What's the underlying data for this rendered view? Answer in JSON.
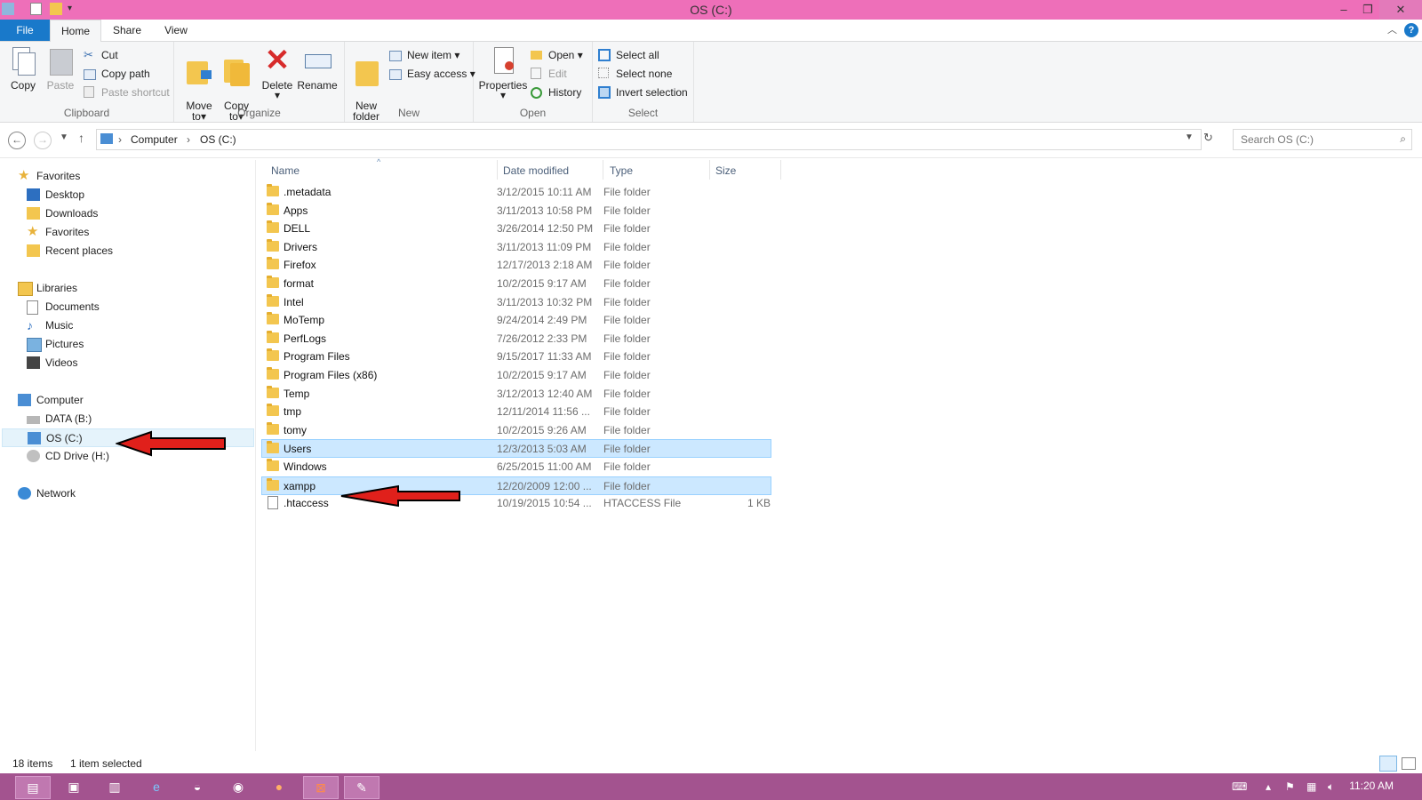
{
  "window": {
    "title": "OS (C:)",
    "minimize_icon": "minimize-icon",
    "restore_icon": "restore-icon",
    "close_icon": "close-icon"
  },
  "tabs": {
    "file": "File",
    "home": "Home",
    "share": "Share",
    "view": "View"
  },
  "ribbon": {
    "clipboard": {
      "label": "Clipboard",
      "copy": "Copy",
      "paste": "Paste",
      "cut": "Cut",
      "copy_path": "Copy path",
      "paste_shortcut": "Paste shortcut"
    },
    "organize": {
      "label": "Organize",
      "move_to": "Move\nto",
      "copy_to": "Copy\nto",
      "delete": "Delete",
      "rename": "Rename"
    },
    "new": {
      "label": "New",
      "new_folder": "New\nfolder",
      "new_item": "New item",
      "easy_access": "Easy access"
    },
    "open": {
      "label": "Open",
      "properties": "Properties",
      "open": "Open",
      "edit": "Edit",
      "history": "History"
    },
    "select": {
      "label": "Select",
      "select_all": "Select all",
      "select_none": "Select none",
      "invert_selection": "Invert selection"
    }
  },
  "address": {
    "crumbs": [
      "Computer",
      "OS (C:)"
    ],
    "search_placeholder": "Search OS (C:)"
  },
  "nav_pane": {
    "favorites": {
      "label": "Favorites",
      "items": [
        "Desktop",
        "Downloads",
        "Favorites",
        "Recent places"
      ]
    },
    "libraries": {
      "label": "Libraries",
      "items": [
        "Documents",
        "Music",
        "Pictures",
        "Videos"
      ]
    },
    "computer": {
      "label": "Computer",
      "items": [
        "DATA (B:)",
        "OS (C:)",
        "CD Drive (H:)"
      ]
    },
    "network": {
      "label": "Network"
    }
  },
  "columns": {
    "name": "Name",
    "date": "Date modified",
    "type": "Type",
    "size": "Size"
  },
  "files": [
    {
      "name": ".metadata",
      "date": "3/12/2015 10:11 AM",
      "type": "File folder",
      "size": ""
    },
    {
      "name": "Apps",
      "date": "3/11/2013 10:58 PM",
      "type": "File folder",
      "size": ""
    },
    {
      "name": "DELL",
      "date": "3/26/2014 12:50 PM",
      "type": "File folder",
      "size": ""
    },
    {
      "name": "Drivers",
      "date": "3/11/2013 11:09 PM",
      "type": "File folder",
      "size": ""
    },
    {
      "name": "Firefox",
      "date": "12/17/2013 2:18 AM",
      "type": "File folder",
      "size": ""
    },
    {
      "name": "format",
      "date": "10/2/2015 9:17 AM",
      "type": "File folder",
      "size": ""
    },
    {
      "name": "Intel",
      "date": "3/11/2013 10:32 PM",
      "type": "File folder",
      "size": ""
    },
    {
      "name": "MoTemp",
      "date": "9/24/2014 2:49 PM",
      "type": "File folder",
      "size": ""
    },
    {
      "name": "PerfLogs",
      "date": "7/26/2012 2:33 PM",
      "type": "File folder",
      "size": ""
    },
    {
      "name": "Program Files",
      "date": "9/15/2017 11:33 AM",
      "type": "File folder",
      "size": ""
    },
    {
      "name": "Program Files (x86)",
      "date": "10/2/2015 9:17 AM",
      "type": "File folder",
      "size": ""
    },
    {
      "name": "Temp",
      "date": "3/12/2013 12:40 AM",
      "type": "File folder",
      "size": ""
    },
    {
      "name": "tmp",
      "date": "12/11/2014 11:56 ...",
      "type": "File folder",
      "size": ""
    },
    {
      "name": "tomy",
      "date": "10/2/2015 9:26 AM",
      "type": "File folder",
      "size": ""
    },
    {
      "name": "Users",
      "date": "12/3/2013 5:03 AM",
      "type": "File folder",
      "size": ""
    },
    {
      "name": "Windows",
      "date": "6/25/2015 11:00 AM",
      "type": "File folder",
      "size": ""
    },
    {
      "name": "xampp",
      "date": "12/20/2009 12:00 ...",
      "type": "File folder",
      "size": ""
    },
    {
      "name": ".htaccess",
      "date": "10/19/2015 10:54 ...",
      "type": "HTACCESS File",
      "size": "1 KB"
    }
  ],
  "status": {
    "items": "18 items",
    "selected": "1 item selected"
  },
  "taskbar": {
    "time": "11:20 AM"
  }
}
